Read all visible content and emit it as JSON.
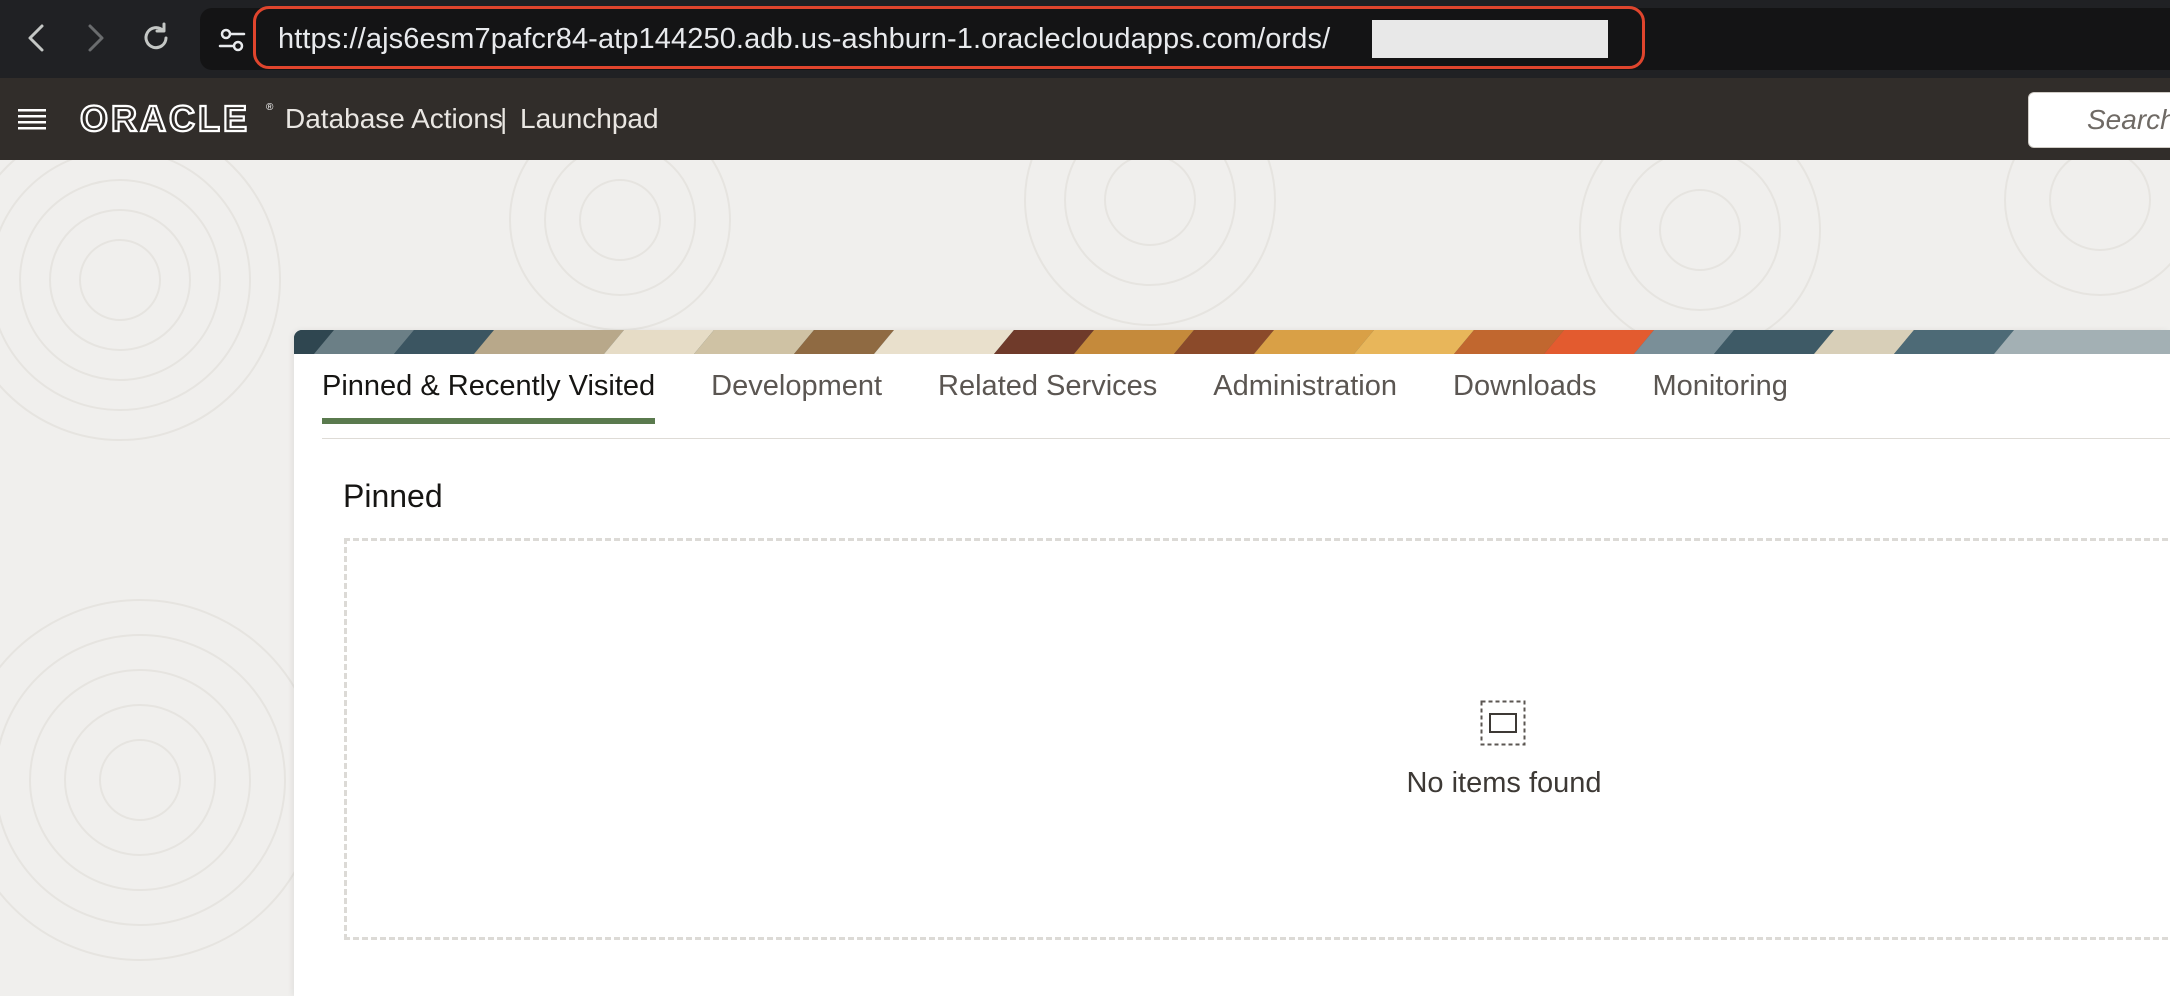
{
  "browser": {
    "url": "https://ajs6esm7pafcr84-atp144250.adb.us-ashburn-1.oraclecloudapps.com/ords/",
    "back_icon": "chevron-left-icon",
    "forward_icon": "chevron-right-icon",
    "reload_icon": "reload-icon",
    "site_settings_icon": "tune-icon",
    "highlight_color": "#e0452d"
  },
  "header": {
    "logo_text": "ORACLE",
    "product": "Database Actions",
    "separator": "|",
    "page": "Launchpad",
    "search_placeholder": "Search",
    "menu_icon": "hamburger-icon",
    "background": "#312d2a"
  },
  "tabs": [
    {
      "label": "Pinned & Recently Visited",
      "active": true
    },
    {
      "label": "Development",
      "active": false
    },
    {
      "label": "Related Services",
      "active": false
    },
    {
      "label": "Administration",
      "active": false
    },
    {
      "label": "Downloads",
      "active": false
    },
    {
      "label": "Monitoring",
      "active": false
    }
  ],
  "active_tab_color": "#5a7a4e",
  "pinned": {
    "title": "Pinned",
    "empty_icon": "empty-placeholder-icon",
    "empty_message": "No items found"
  }
}
